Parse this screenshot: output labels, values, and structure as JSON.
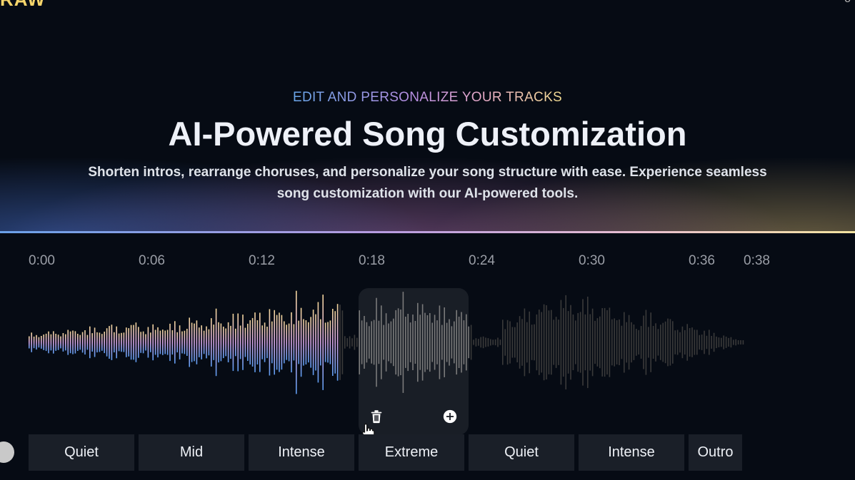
{
  "brand": {
    "logo_text": "RAW",
    "corner_mark": "o"
  },
  "hero": {
    "eyebrow": "EDIT AND PERSONALIZE YOUR TRACKS",
    "title": "AI-Powered Song Customization",
    "subtitle_line1": "Shorten intros, rearrange choruses, and personalize your song structure with ease. Experience seamless",
    "subtitle_line2": "song customization with our AI-powered tools."
  },
  "timeline": {
    "ticks": [
      "0:00",
      "0:06",
      "0:12",
      "0:18",
      "0:24",
      "0:30",
      "0:36",
      "0:38"
    ]
  },
  "waveform": {
    "played_until_seconds": 18,
    "selected_segment": "Extreme",
    "colors": {
      "gradient_top": "#f2d59a",
      "gradient_mid": "#d7a7e6",
      "gradient_bottom": "#5d9cf0",
      "selected": "#7a7a7a",
      "unplayed": "#3a3a3a"
    }
  },
  "segment_actions": {
    "delete_icon": "trash-icon",
    "add_icon": "plus-circle-icon"
  },
  "sections": [
    {
      "label": "Quiet"
    },
    {
      "label": "Mid"
    },
    {
      "label": "Intense"
    },
    {
      "label": "Extreme"
    },
    {
      "label": "Quiet"
    },
    {
      "label": "Intense"
    },
    {
      "label": "Outro"
    }
  ]
}
